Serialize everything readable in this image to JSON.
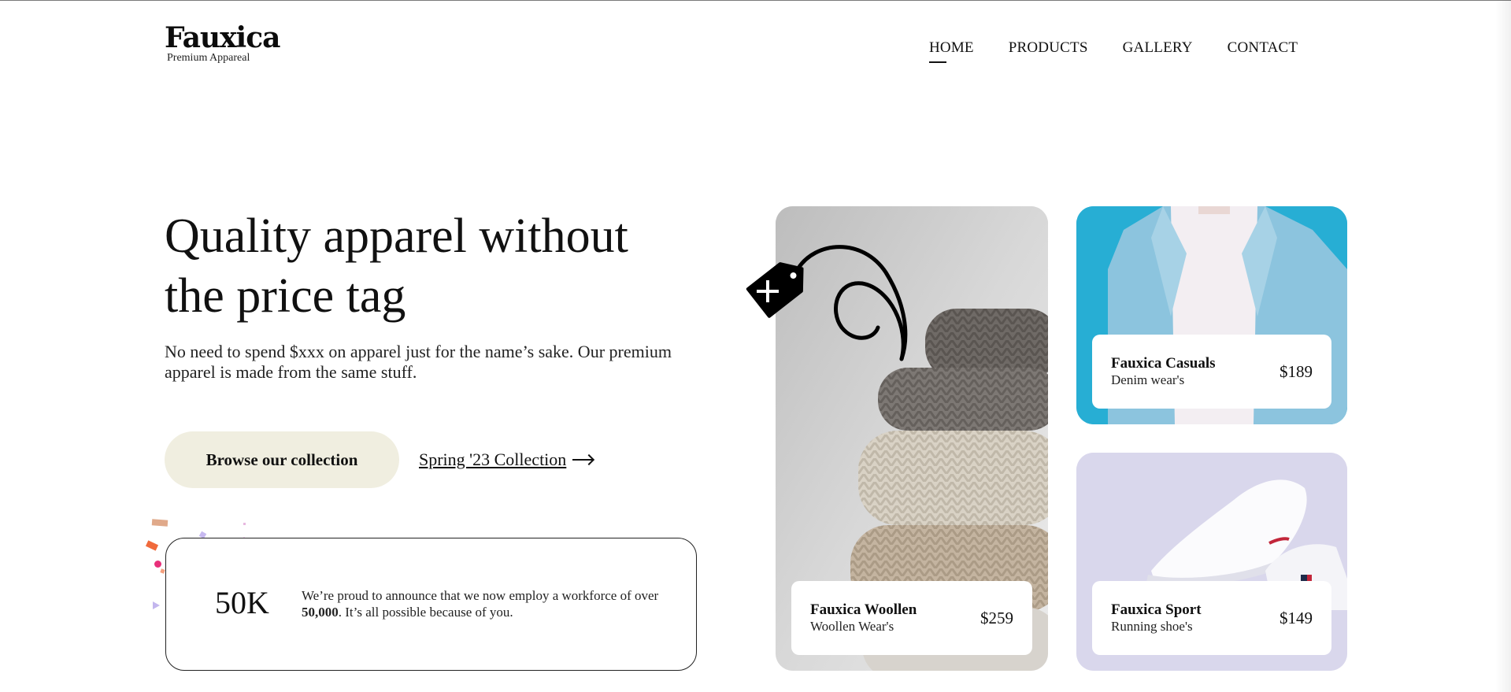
{
  "brand": {
    "name": "Fauxica",
    "tagline": "Premium Appareal"
  },
  "nav": [
    {
      "label": "HOME",
      "active": true
    },
    {
      "label": "PRODUCTS",
      "active": false
    },
    {
      "label": "GALLERY",
      "active": false
    },
    {
      "label": "CONTACT",
      "active": false
    }
  ],
  "hero": {
    "title": "Quality apparel without the price tag",
    "subtitle": "No need to spend $xxx on apparel just for the name’s sake. Our premium apparel is made from the same stuff.",
    "cta_label": "Browse our collection",
    "collection_link": "Spring '23 Collection"
  },
  "stat": {
    "number": "50K",
    "text_before": "We’re proud to announce that we now employ a workforce of over ",
    "text_bold": "50,000",
    "text_after": ". It’s all possible because of you."
  },
  "products": [
    {
      "name": "Fauxica Woollen",
      "category": "Woollen Wear's",
      "price": "$259",
      "image": "stacked knit sweaters"
    },
    {
      "name": "Fauxica Casuals",
      "category": "Denim wear's",
      "price": "$189",
      "image": "denim jacket"
    },
    {
      "name": "Fauxica Sport",
      "category": "Running shoe's",
      "price": "$149",
      "image": "white sneakers"
    }
  ],
  "colors": {
    "cta_bg": "#f0eee0",
    "casual_bg": "#1ea6cf",
    "sport_bg": "#dcdaee",
    "woollen_bg": "#d2d2d2"
  },
  "icons": {
    "price_tag": "price-tag-icon",
    "arrow": "arrow-right-icon"
  }
}
